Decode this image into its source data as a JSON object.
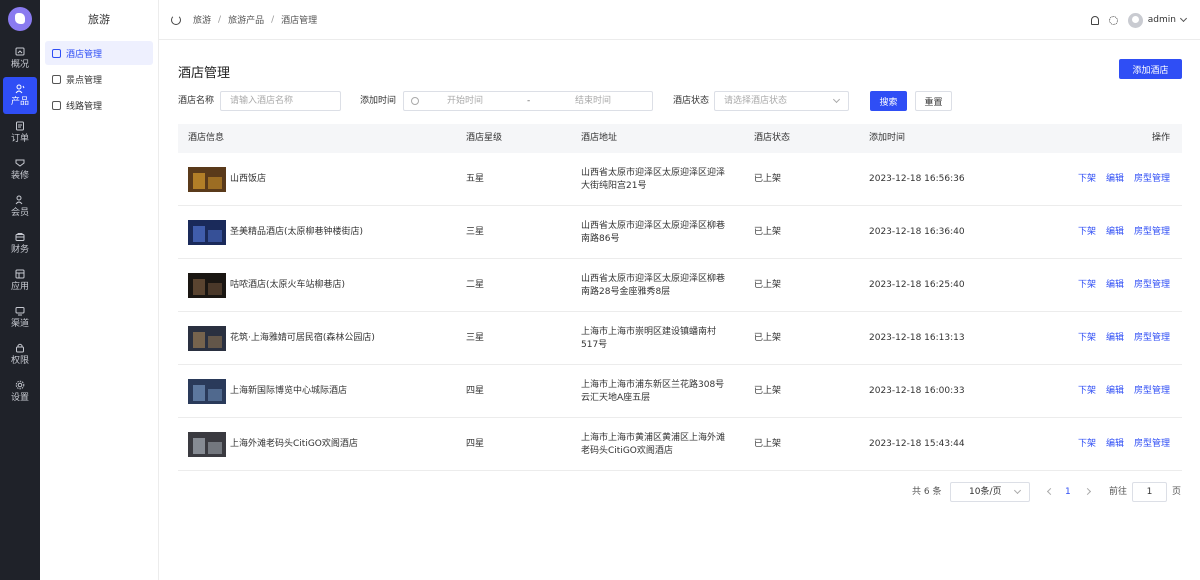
{
  "rail": [
    {
      "label": "概况",
      "icon": "overview-icon"
    },
    {
      "label": "产品",
      "icon": "product-icon",
      "active": true
    },
    {
      "label": "订单",
      "icon": "order-icon"
    },
    {
      "label": "装修",
      "icon": "decor-icon"
    },
    {
      "label": "会员",
      "icon": "member-icon"
    },
    {
      "label": "财务",
      "icon": "finance-icon"
    },
    {
      "label": "应用",
      "icon": "app-icon"
    },
    {
      "label": "渠道",
      "icon": "channel-icon"
    },
    {
      "label": "权限",
      "icon": "lock-icon"
    },
    {
      "label": "设置",
      "icon": "settings-icon"
    }
  ],
  "submenu": {
    "title": "旅游",
    "items": [
      {
        "label": "酒店管理",
        "active": true
      },
      {
        "label": "景点管理"
      },
      {
        "label": "线路管理"
      }
    ]
  },
  "breadcrumb": [
    "旅游",
    "旅游产品",
    "酒店管理"
  ],
  "user": {
    "name": "admin"
  },
  "page": {
    "title": "酒店管理",
    "add_button": "添加酒店"
  },
  "filters": {
    "name_label": "酒店名称",
    "name_placeholder": "请输入酒店名称",
    "time_label": "添加时间",
    "start_placeholder": "开始时间",
    "range_sep": "-",
    "end_placeholder": "结束时间",
    "status_label": "酒店状态",
    "status_placeholder": "请选择酒店状态",
    "search_button": "搜索",
    "reset_button": "重置"
  },
  "table": {
    "headers": [
      "酒店信息",
      "酒店星级",
      "酒店地址",
      "酒店状态",
      "添加时间",
      "操作"
    ],
    "rows": [
      {
        "name": "山西饭店",
        "star": "五星",
        "address": "山西省太原市迎泽区太原迎泽区迎泽大街纯阳宫21号",
        "status": "已上架",
        "time": "2023-12-18 16:56:36"
      },
      {
        "name": "圣美精品酒店(太原柳巷钟楼街店)",
        "star": "三星",
        "address": "山西省太原市迎泽区太原迎泽区柳巷南路86号",
        "status": "已上架",
        "time": "2023-12-18 16:36:40"
      },
      {
        "name": "咕哝酒店(太原火车站柳巷店)",
        "star": "二星",
        "address": "山西省太原市迎泽区太原迎泽区柳巷南路28号金座雅秀8层",
        "status": "已上架",
        "time": "2023-12-18 16:25:40"
      },
      {
        "name": "花筑·上海雅婧可居民宿(森林公园店)",
        "star": "三星",
        "address": "上海市上海市崇明区建设镇蟠南村517号",
        "status": "已上架",
        "time": "2023-12-18 16:13:13"
      },
      {
        "name": "上海新国际博览中心城际酒店",
        "star": "四星",
        "address": "上海市上海市浦东新区兰花路308号云汇天地A座五层",
        "status": "已上架",
        "time": "2023-12-18 16:00:33"
      },
      {
        "name": "上海外滩老码头CitiGO欢阁酒店",
        "star": "四星",
        "address": "上海市上海市黄浦区黄浦区上海外滩老码头CitiGO欢阁酒店",
        "status": "已上架",
        "time": "2023-12-18 15:43:44"
      }
    ],
    "ops": [
      "下架",
      "编辑",
      "房型管理"
    ]
  },
  "pagination": {
    "total": "共 6 条",
    "page_size": "10条/页",
    "current": "1",
    "goto_label": "前往",
    "goto_value": "1",
    "goto_unit": "页"
  }
}
